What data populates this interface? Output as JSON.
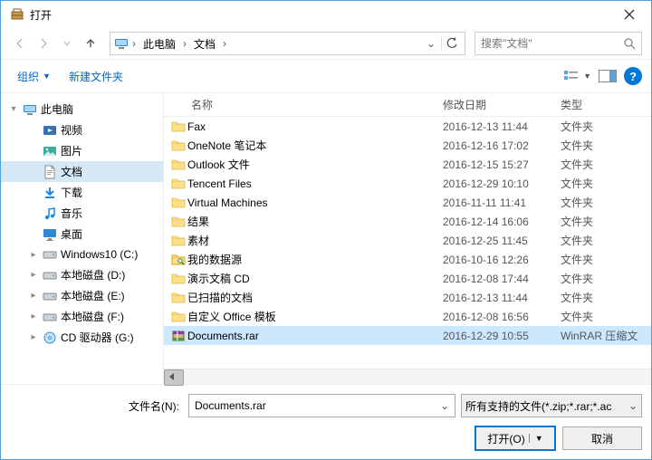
{
  "title": "打开",
  "nav": {
    "path": [
      "此电脑",
      "文档"
    ],
    "search_placeholder": "搜索\"文档\""
  },
  "toolbar": {
    "organize": "组织",
    "new_folder": "新建文件夹"
  },
  "columns": {
    "name": "名称",
    "modified": "修改日期",
    "type": "类型"
  },
  "sidebar": [
    {
      "label": "此电脑",
      "icon": "pc",
      "indent": 0,
      "twisty": "▾"
    },
    {
      "label": "视频",
      "icon": "video",
      "indent": 1
    },
    {
      "label": "图片",
      "icon": "pictures",
      "indent": 1
    },
    {
      "label": "文档",
      "icon": "documents",
      "indent": 1,
      "selected": true
    },
    {
      "label": "下载",
      "icon": "downloads",
      "indent": 1
    },
    {
      "label": "音乐",
      "icon": "music",
      "indent": 1
    },
    {
      "label": "桌面",
      "icon": "desktop",
      "indent": 1
    },
    {
      "label": "Windows10 (C:)",
      "icon": "drive",
      "indent": 1,
      "twisty": "▸"
    },
    {
      "label": "本地磁盘 (D:)",
      "icon": "drive",
      "indent": 1,
      "twisty": "▸"
    },
    {
      "label": "本地磁盘 (E:)",
      "icon": "drive",
      "indent": 1,
      "twisty": "▸"
    },
    {
      "label": "本地磁盘 (F:)",
      "icon": "drive",
      "indent": 1,
      "twisty": "▸"
    },
    {
      "label": "CD 驱动器 (G:)",
      "icon": "cd",
      "indent": 1,
      "twisty": "▸"
    }
  ],
  "files": [
    {
      "name": "Fax",
      "date": "2016-12-13 11:44",
      "type": "文件夹",
      "icon": "folder"
    },
    {
      "name": "OneNote 笔记本",
      "date": "2016-12-16 17:02",
      "type": "文件夹",
      "icon": "folder"
    },
    {
      "name": "Outlook 文件",
      "date": "2016-12-15 15:27",
      "type": "文件夹",
      "icon": "folder"
    },
    {
      "name": "Tencent Files",
      "date": "2016-12-29 10:10",
      "type": "文件夹",
      "icon": "folder"
    },
    {
      "name": "Virtual Machines",
      "date": "2016-11-11 11:41",
      "type": "文件夹",
      "icon": "folder"
    },
    {
      "name": "结果",
      "date": "2016-12-14 16:06",
      "type": "文件夹",
      "icon": "folder"
    },
    {
      "name": "素材",
      "date": "2016-12-25 11:45",
      "type": "文件夹",
      "icon": "folder"
    },
    {
      "name": "我的数据源",
      "date": "2016-10-16 12:26",
      "type": "文件夹",
      "icon": "datasrc"
    },
    {
      "name": "演示文稿 CD",
      "date": "2016-12-08 17:44",
      "type": "文件夹",
      "icon": "folder"
    },
    {
      "name": "已扫描的文档",
      "date": "2016-12-13 11:44",
      "type": "文件夹",
      "icon": "folder"
    },
    {
      "name": "自定义 Office 模板",
      "date": "2016-12-08 16:56",
      "type": "文件夹",
      "icon": "folder"
    },
    {
      "name": "Documents.rar",
      "date": "2016-12-29 10:55",
      "type": "WinRAR 压缩文",
      "icon": "rar",
      "selected": true
    }
  ],
  "footer": {
    "filename_label": "文件名(N):",
    "filename_value": "Documents.rar",
    "filter": "所有支持的文件(*.zip;*.rar;*.ac",
    "open": "打开(O)",
    "cancel": "取消"
  },
  "dropdown": "⌄",
  "help": "?"
}
